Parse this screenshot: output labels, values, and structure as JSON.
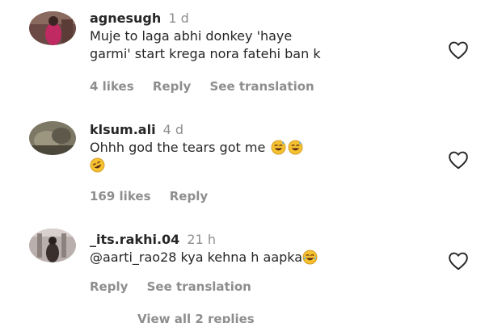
{
  "comments": [
    {
      "username": "agnesugh",
      "time": "1 d",
      "text_line1": "Muje to laga abhi donkey 'haye",
      "text_line2": "garmi' start krega nora fatehi ban k",
      "likes": "4 likes",
      "reply": "Reply",
      "translate": "See translation",
      "like_icon": "heart-outline-icon"
    },
    {
      "username": "klsum.ali",
      "time": "4 d",
      "text": "Ohhh god the tears got me",
      "emojis": [
        "😅",
        "😅",
        "🤣"
      ],
      "likes": "169 likes",
      "reply": "Reply",
      "like_icon": "heart-outline-icon"
    },
    {
      "username": "_its.rakhi.04",
      "time": "21 h",
      "mention": "@aarti_rao28",
      "text": " kya kehna h aapka",
      "emojis": [
        "😂"
      ],
      "reply": "Reply",
      "translate": "See translation",
      "like_icon": "heart-outline-icon"
    }
  ],
  "footer": {
    "view_replies": "View all 2 replies"
  },
  "colors": {
    "text": "#262626",
    "secondary": "#8e8e8e",
    "emoji_face": "#f5c12e"
  }
}
